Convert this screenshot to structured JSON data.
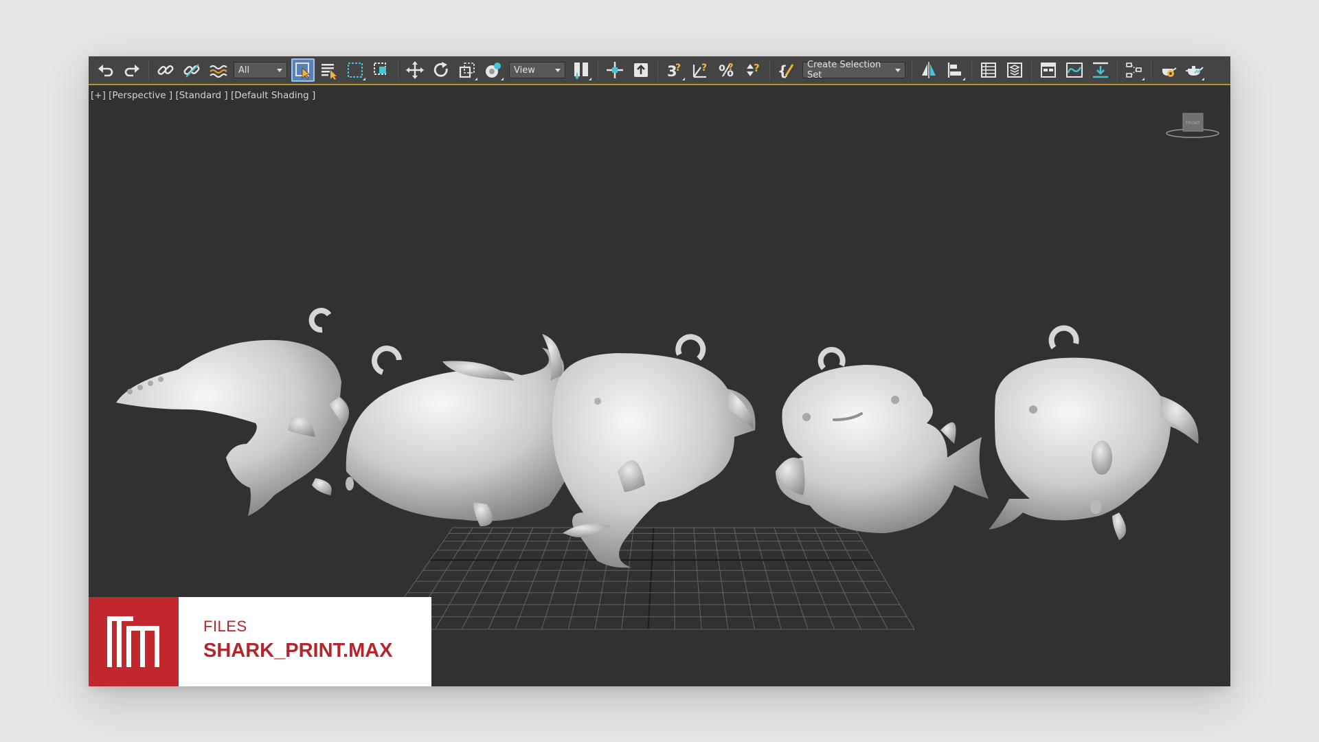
{
  "toolbar": {
    "selection_filter": "All",
    "reference_coordinate_system": "View",
    "named_selection_set": "Create Selection Set",
    "icons": [
      "undo-icon",
      "redo-icon",
      "link-icon",
      "unlink-icon",
      "bind-to-space-warp-icon",
      "select-object-icon",
      "select-by-name-icon",
      "rectangular-selection-icon",
      "window-crossing-icon",
      "select-and-move-icon",
      "select-and-rotate-icon",
      "select-and-scale-icon",
      "select-and-place-icon",
      "use-pivot-center-icon",
      "select-and-manipulate-icon",
      "keyboard-shortcut-override-icon",
      "snaps-toggle-icon",
      "angle-snap-icon",
      "percent-snap-icon",
      "spinner-snap-icon",
      "edit-named-selection-icon",
      "mirror-icon",
      "align-icon",
      "scene-explorer-icon",
      "layer-explorer-icon",
      "toggle-ribbon-icon",
      "curve-editor-icon",
      "dope-sheet-icon",
      "schematic-view-icon",
      "render-setup-icon",
      "render-production-icon"
    ]
  },
  "viewport": {
    "label": "[+] [Perspective ] [Standard ] [Default Shading ]",
    "viewcube_face": "FRONT",
    "objects": [
      "shark-charm-1",
      "shark-charm-2",
      "shark-charm-3",
      "shark-charm-4",
      "shark-charm-5"
    ]
  },
  "file_banner": {
    "kicker": "FILES",
    "filename": "SHARK_PRINT.MAX",
    "logo": "TM"
  },
  "colors": {
    "page_bg": "#e6e6e6",
    "viewport_bg": "#313131",
    "toolbar_bg": "#444444",
    "toolbar_accent": "#b5922b",
    "active_tool": "#5a81b5",
    "brand_red": "#c1272d"
  }
}
